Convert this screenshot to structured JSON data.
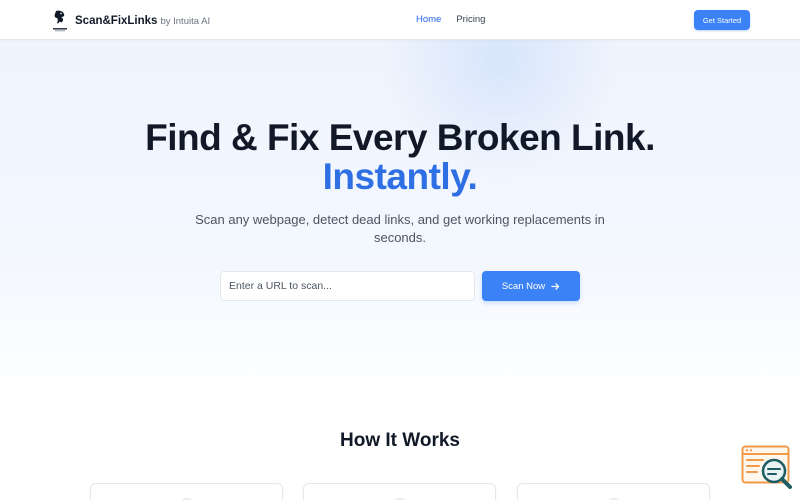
{
  "header": {
    "brand_name": "Scan&FixLinks",
    "brand_by": "by Intuita AI",
    "nav": [
      {
        "label": "Home",
        "active": true
      },
      {
        "label": "Pricing",
        "active": false
      }
    ],
    "cta_label": "Get Started"
  },
  "hero": {
    "title": "Find & Fix Every Broken Link.",
    "title_accent": "Instantly.",
    "subtitle": "Scan any webpage, detect dead links, and get working replacements in seconds.",
    "input_placeholder": "Enter a URL to scan...",
    "input_value": "",
    "scan_button_label": "Scan Now"
  },
  "how_it_works": {
    "title": "How It Works"
  },
  "icons": {
    "logo": "mascot-logo",
    "scan_button": "arrow-right-icon",
    "widget": "browser-search-icon"
  },
  "colors": {
    "primary": "#3b82f6",
    "accent_text": "#2f6fe4",
    "widget_orange": "#f29a4a",
    "widget_teal": "#1d5c63"
  }
}
